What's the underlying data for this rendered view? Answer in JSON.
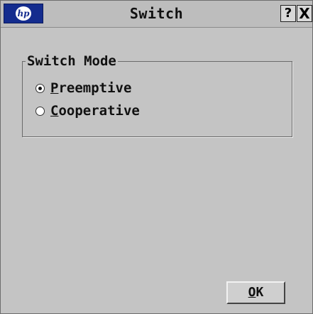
{
  "window": {
    "title": "Switch",
    "logo_text": "hp",
    "help_label": "?",
    "close_label": "X"
  },
  "switch_mode": {
    "legend": "Switch Mode",
    "options": [
      {
        "mnemonic": "P",
        "rest": "reemptive",
        "selected": true
      },
      {
        "mnemonic": "C",
        "rest": "ooperative",
        "selected": false
      }
    ]
  },
  "buttons": {
    "ok_mnemonic": "O",
    "ok_rest": "K"
  },
  "colors": {
    "window_bg": "#c4c4c4",
    "logo_bg": "#142c8e"
  },
  "icons": {
    "logo": "hp-logo-icon",
    "help": "help-icon",
    "close": "close-icon"
  }
}
